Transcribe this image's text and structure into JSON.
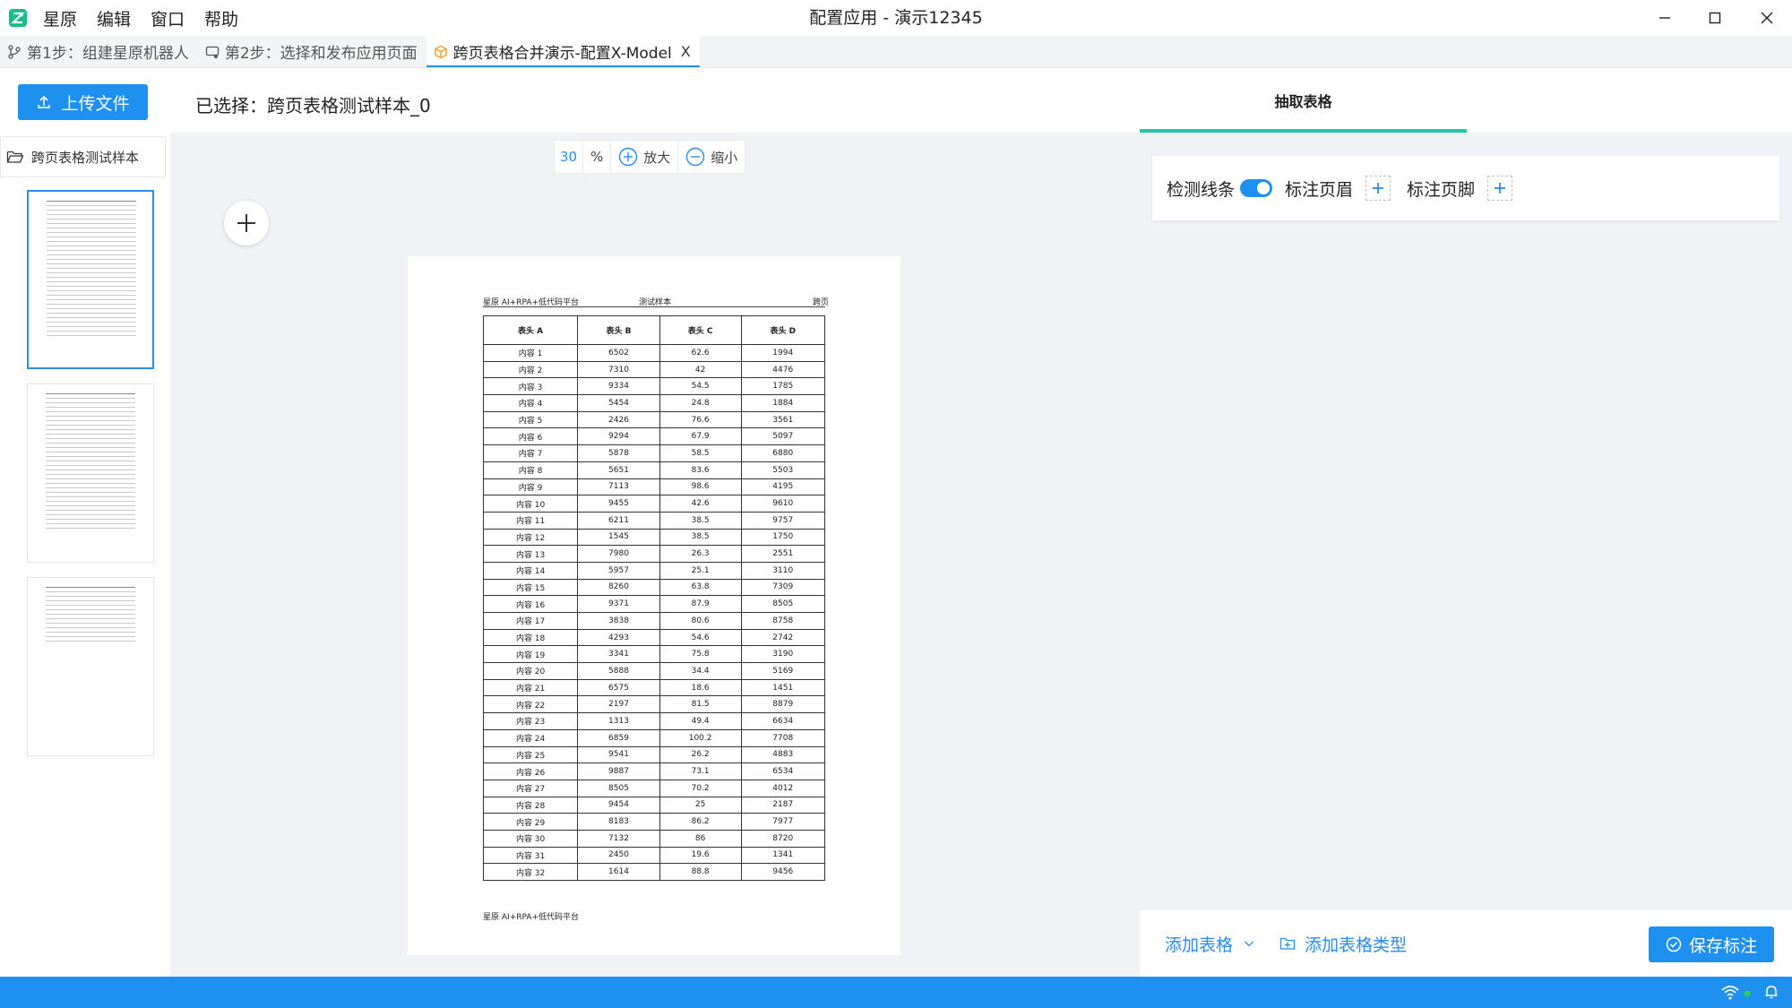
{
  "titlebar": {
    "menu": [
      "星原",
      "编辑",
      "窗口",
      "帮助"
    ],
    "window_title": "配置应用 - 演示12345"
  },
  "tabs": [
    {
      "label": "第1步：组建星原机器人",
      "icon": "branch-icon",
      "active": false
    },
    {
      "label": "第2步：选择和发布应用页面",
      "icon": "flow-icon",
      "active": false
    },
    {
      "label": "跨页表格合并演示-配置X-Model",
      "icon": "cube-icon",
      "active": true,
      "close": "X"
    }
  ],
  "toolbar": {
    "upload_label": "上传文件",
    "selected_text": "已选择：跨页表格测试样本_0"
  },
  "sidebar": {
    "folder_label": "跨页表格测试样本",
    "pages": 3
  },
  "viewer": {
    "zoom_value": "30",
    "zoom_unit": "%",
    "zoom_in_label": "放大",
    "zoom_out_label": "缩小"
  },
  "document": {
    "header_left": "星原 AI+RPA+低代码平台",
    "header_center": "测试样本",
    "header_right": "跨页",
    "footer": "星原 AI+RPA+低代码平台",
    "columns": [
      "表头 A",
      "表头 B",
      "表头 C",
      "表头 D"
    ],
    "rows": [
      [
        "内容 1",
        "6502",
        "62.6",
        "1994"
      ],
      [
        "内容 2",
        "7310",
        "42",
        "4476"
      ],
      [
        "内容 3",
        "9334",
        "54.5",
        "1785"
      ],
      [
        "内容 4",
        "5454",
        "24.8",
        "1884"
      ],
      [
        "内容 5",
        "2426",
        "76.6",
        "3561"
      ],
      [
        "内容 6",
        "9294",
        "67.9",
        "5097"
      ],
      [
        "内容 7",
        "5878",
        "58.5",
        "6880"
      ],
      [
        "内容 8",
        "5651",
        "83.6",
        "5503"
      ],
      [
        "内容 9",
        "7113",
        "98.6",
        "4195"
      ],
      [
        "内容 10",
        "9455",
        "42.6",
        "9610"
      ],
      [
        "内容 11",
        "6211",
        "38.5",
        "9757"
      ],
      [
        "内容 12",
        "1545",
        "38.5",
        "1750"
      ],
      [
        "内容 13",
        "7980",
        "26.3",
        "2551"
      ],
      [
        "内容 14",
        "5957",
        "25.1",
        "3110"
      ],
      [
        "内容 15",
        "8260",
        "63.8",
        "7309"
      ],
      [
        "内容 16",
        "9371",
        "87.9",
        "8505"
      ],
      [
        "内容 17",
        "3838",
        "80.6",
        "8758"
      ],
      [
        "内容 18",
        "4293",
        "54.6",
        "2742"
      ],
      [
        "内容 19",
        "3341",
        "75.8",
        "3190"
      ],
      [
        "内容 20",
        "5888",
        "34.4",
        "5169"
      ],
      [
        "内容 21",
        "6575",
        "18.6",
        "1451"
      ],
      [
        "内容 22",
        "2197",
        "81.5",
        "8879"
      ],
      [
        "内容 23",
        "1313",
        "49.4",
        "6634"
      ],
      [
        "内容 24",
        "6859",
        "100.2",
        "7708"
      ],
      [
        "内容 25",
        "9541",
        "26.2",
        "4883"
      ],
      [
        "内容 26",
        "9887",
        "73.1",
        "6534"
      ],
      [
        "内容 27",
        "8505",
        "70.2",
        "4012"
      ],
      [
        "内容 28",
        "9454",
        "25",
        "2187"
      ],
      [
        "内容 29",
        "8183",
        "86.2",
        "7977"
      ],
      [
        "内容 30",
        "7132",
        "86",
        "8720"
      ],
      [
        "内容 31",
        "2450",
        "19.6",
        "1341"
      ],
      [
        "内容 32",
        "1614",
        "88.8",
        "9456"
      ]
    ]
  },
  "right_panel": {
    "tab_label": "抽取表格",
    "detect_lines_label": "检测线条",
    "detect_lines_on": true,
    "mark_header_label": "标注页眉",
    "mark_footer_label": "标注页脚",
    "add_table_label": "添加表格",
    "add_table_type_label": "添加表格类型",
    "save_label": "保存标注"
  },
  "colors": {
    "primary": "#1e90f0",
    "tab_indicator": "#1ec7a6",
    "logo": "#17c08a"
  }
}
